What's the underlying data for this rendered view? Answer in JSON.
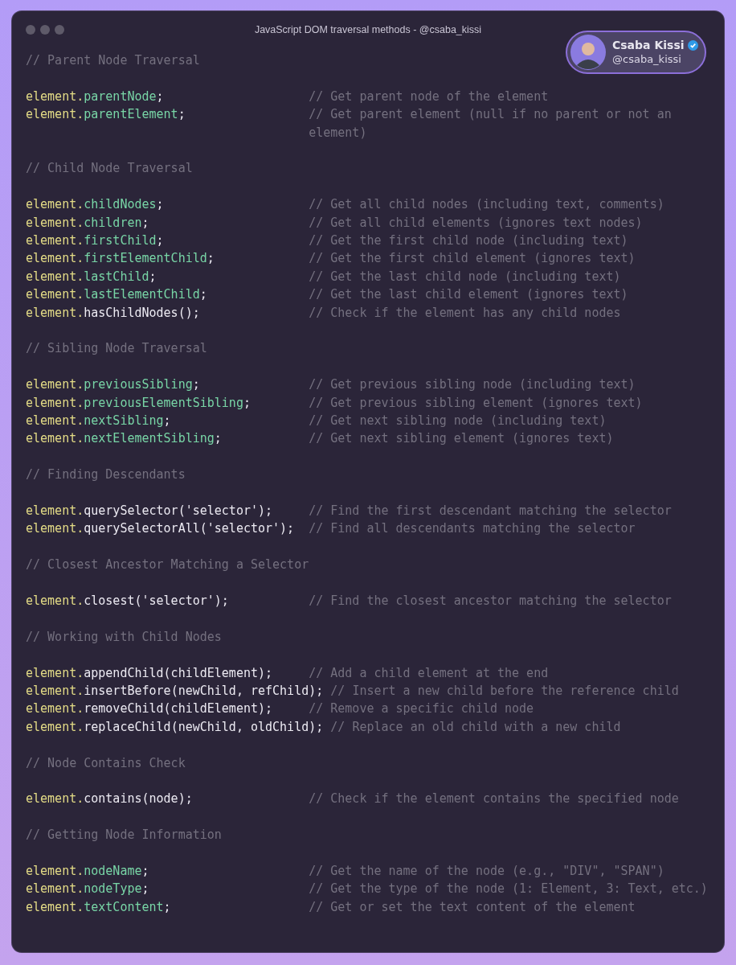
{
  "window": {
    "title": "JavaScript DOM traversal methods - @csaba_kissi"
  },
  "profile": {
    "name": "Csaba Kissi",
    "handle": "@csaba_kissi",
    "verified": true
  },
  "lines": [
    {
      "kind": "heading",
      "text": "// Parent Node Traversal"
    },
    {
      "kind": "blank"
    },
    {
      "kind": "code",
      "object": "element.",
      "member": "parentNode",
      "method": false,
      "tail": ";",
      "comment": "// Get parent node of the element"
    },
    {
      "kind": "code",
      "object": "element.",
      "member": "parentElement",
      "method": false,
      "tail": ";",
      "comment": "// Get parent element (null if no parent or not an element)"
    },
    {
      "kind": "blank"
    },
    {
      "kind": "heading",
      "text": "// Child Node Traversal"
    },
    {
      "kind": "blank"
    },
    {
      "kind": "code",
      "object": "element.",
      "member": "childNodes",
      "method": false,
      "tail": ";",
      "comment": "// Get all child nodes (including text, comments)"
    },
    {
      "kind": "code",
      "object": "element.",
      "member": "children",
      "method": false,
      "tail": ";",
      "comment": "// Get all child elements (ignores text nodes)"
    },
    {
      "kind": "code",
      "object": "element.",
      "member": "firstChild",
      "method": false,
      "tail": ";",
      "comment": "// Get the first child node (including text)"
    },
    {
      "kind": "code",
      "object": "element.",
      "member": "firstElementChild",
      "method": false,
      "tail": ";",
      "comment": "// Get the first child element (ignores text)"
    },
    {
      "kind": "code",
      "object": "element.",
      "member": "lastChild",
      "method": false,
      "tail": ";",
      "comment": "// Get the last child node (including text)"
    },
    {
      "kind": "code",
      "object": "element.",
      "member": "lastElementChild",
      "method": false,
      "tail": ";",
      "comment": "// Get the last child element (ignores text)"
    },
    {
      "kind": "code",
      "object": "element.",
      "member": "hasChildNodes",
      "method": true,
      "tail": "();",
      "comment": "// Check if the element has any child nodes"
    },
    {
      "kind": "blank"
    },
    {
      "kind": "heading",
      "text": "// Sibling Node Traversal"
    },
    {
      "kind": "blank"
    },
    {
      "kind": "code",
      "object": "element.",
      "member": "previousSibling",
      "method": false,
      "tail": ";",
      "comment": "// Get previous sibling node (including text)"
    },
    {
      "kind": "code",
      "object": "element.",
      "member": "previousElementSibling",
      "method": false,
      "tail": ";",
      "comment": "// Get previous sibling element (ignores text)"
    },
    {
      "kind": "code",
      "object": "element.",
      "member": "nextSibling",
      "method": false,
      "tail": ";",
      "comment": "// Get next sibling node (including text)"
    },
    {
      "kind": "code",
      "object": "element.",
      "member": "nextElementSibling",
      "method": false,
      "tail": ";",
      "comment": "// Get next sibling element (ignores text)"
    },
    {
      "kind": "blank"
    },
    {
      "kind": "heading",
      "text": "// Finding Descendants"
    },
    {
      "kind": "blank"
    },
    {
      "kind": "code",
      "object": "element.",
      "member": "querySelector",
      "method": true,
      "tail": "('selector');",
      "comment": "// Find the first descendant matching the selector"
    },
    {
      "kind": "code",
      "object": "element.",
      "member": "querySelectorAll",
      "method": true,
      "tail": "('selector');",
      "comment": "// Find all descendants matching the selector"
    },
    {
      "kind": "blank"
    },
    {
      "kind": "heading",
      "text": "// Closest Ancestor Matching a Selector"
    },
    {
      "kind": "blank"
    },
    {
      "kind": "code",
      "object": "element.",
      "member": "closest",
      "method": true,
      "tail": "('selector');",
      "comment": "// Find the closest ancestor matching the selector"
    },
    {
      "kind": "blank"
    },
    {
      "kind": "heading",
      "text": "// Working with Child Nodes"
    },
    {
      "kind": "blank"
    },
    {
      "kind": "code",
      "object": "element.",
      "member": "appendChild",
      "method": true,
      "tail": "(childElement);",
      "comment": "// Add a child element at the end"
    },
    {
      "kind": "code",
      "object": "element.",
      "member": "insertBefore",
      "method": true,
      "tail": "(newChild, refChild);",
      "comment": "// Insert a new child before the reference child"
    },
    {
      "kind": "code",
      "object": "element.",
      "member": "removeChild",
      "method": true,
      "tail": "(childElement);",
      "comment": "// Remove a specific child node"
    },
    {
      "kind": "code",
      "object": "element.",
      "member": "replaceChild",
      "method": true,
      "tail": "(newChild, oldChild);",
      "comment": "// Replace an old child with a new child"
    },
    {
      "kind": "blank"
    },
    {
      "kind": "heading",
      "text": "// Node Contains Check"
    },
    {
      "kind": "blank"
    },
    {
      "kind": "code",
      "object": "element.",
      "member": "contains",
      "method": true,
      "tail": "(node);",
      "comment": "// Check if the element contains the specified node"
    },
    {
      "kind": "blank"
    },
    {
      "kind": "heading",
      "text": "// Getting Node Information"
    },
    {
      "kind": "blank"
    },
    {
      "kind": "code",
      "object": "element.",
      "member": "nodeName",
      "method": false,
      "tail": ";",
      "comment": "// Get the name of the node (e.g., \"DIV\", \"SPAN\")"
    },
    {
      "kind": "code",
      "object": "element.",
      "member": "nodeType",
      "method": false,
      "tail": ";",
      "comment": "// Get the type of the node (1: Element, 3: Text, etc.)"
    },
    {
      "kind": "code",
      "object": "element.",
      "member": "textContent",
      "method": false,
      "tail": ";",
      "comment": "// Get or set the text content of the element"
    }
  ]
}
